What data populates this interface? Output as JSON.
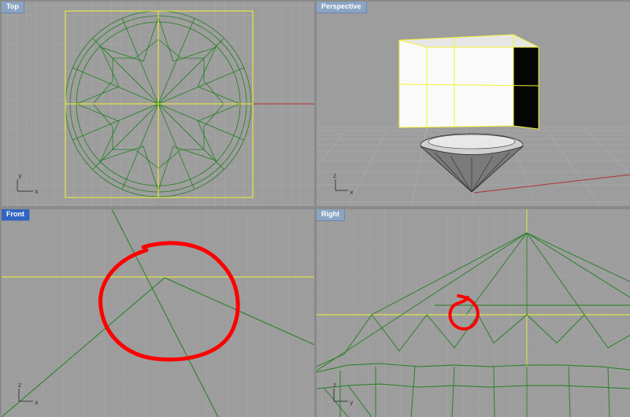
{
  "viewports": {
    "top": {
      "label": "Top",
      "active": false
    },
    "perspective": {
      "label": "Perspective",
      "active": false
    },
    "front": {
      "label": "Front",
      "active": true
    },
    "right": {
      "label": "Right",
      "active": false
    }
  },
  "axes": {
    "top": {
      "vertical": "y",
      "horizontal": "x"
    },
    "perspective": {
      "vertical": "z",
      "horizontal": "x"
    },
    "front": {
      "vertical": "z",
      "horizontal": "x"
    },
    "right": {
      "vertical": "z",
      "horizontal": "y"
    }
  },
  "colors": {
    "viewport_bg": "#9d9d9d",
    "grid_minor": "#b0b0b0",
    "grid_major": "#8e8e8e",
    "wireframe": "#1f7f1f",
    "selected": "#f2f233",
    "x_axis": "#b33030",
    "markup": "#ff0000",
    "tab_inactive": "#8aa4c4",
    "tab_active": "#3165c4"
  }
}
